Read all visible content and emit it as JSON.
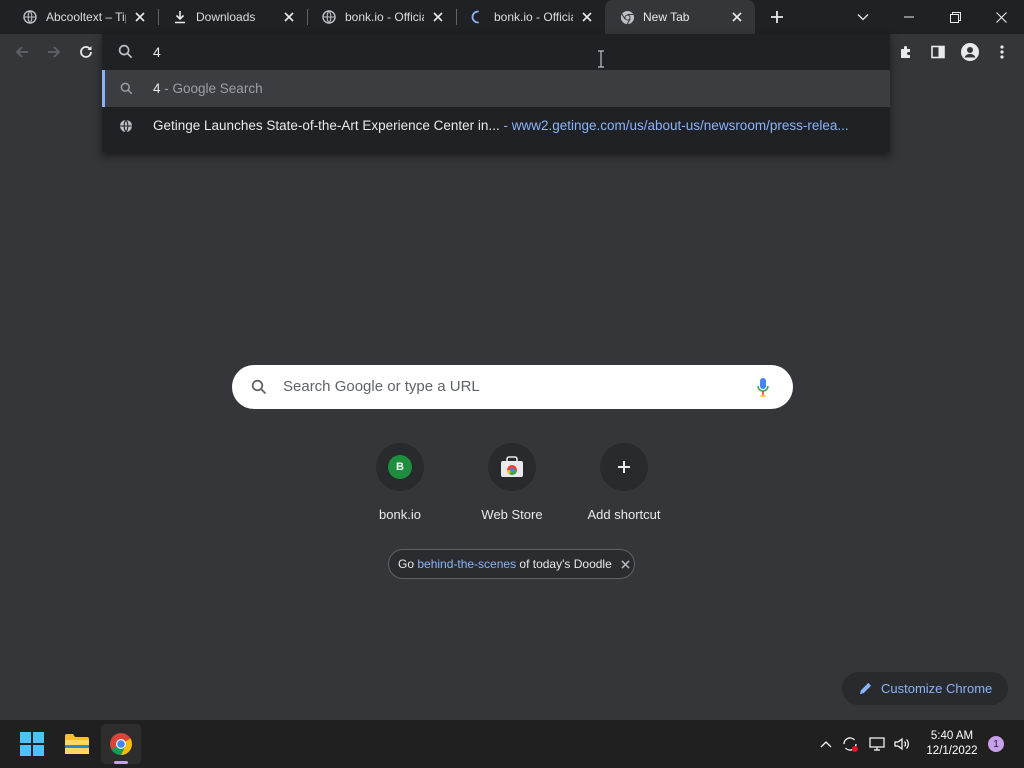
{
  "tabs": [
    {
      "title": "Abcooltext – Tip",
      "icon": "globe-icon",
      "active": false
    },
    {
      "title": "Downloads",
      "icon": "download-icon",
      "active": false
    },
    {
      "title": "bonk.io - Officia",
      "icon": "globe-icon",
      "active": false
    },
    {
      "title": "bonk.io - Officia",
      "icon": "loading-spinner-icon",
      "active": false
    },
    {
      "title": "New Tab",
      "icon": "chrome-icon",
      "active": true
    }
  ],
  "omnibox": {
    "value": "4",
    "suggestions": [
      {
        "icon": "search-icon",
        "main": "4",
        "sep": " - ",
        "sub": "Google Search"
      },
      {
        "icon": "globe-icon",
        "main": "Getinge Launches State-of-the-Art Experience Center in...",
        "sep": " - ",
        "sub": "www2.getinge.com/us/about-us/newsroom/press-relea..."
      }
    ]
  },
  "ntp": {
    "search_placeholder": "Search Google or type a URL",
    "shortcuts": [
      {
        "label": "bonk.io",
        "letter": "B"
      },
      {
        "label": "Web Store"
      },
      {
        "label": "Add shortcut"
      }
    ],
    "doodle": {
      "pre": "Go ",
      "link": "behind-the-scenes",
      "post": " of today's Doodle"
    },
    "customize_label": "Customize Chrome"
  },
  "taskbar": {
    "time": "5:40 AM",
    "date": "12/1/2022",
    "notification_count": "1"
  },
  "colors": {
    "accent": "#8ab4f8",
    "bonk_badge": "#1e8e3e",
    "mic_blue": "#4285f4"
  }
}
